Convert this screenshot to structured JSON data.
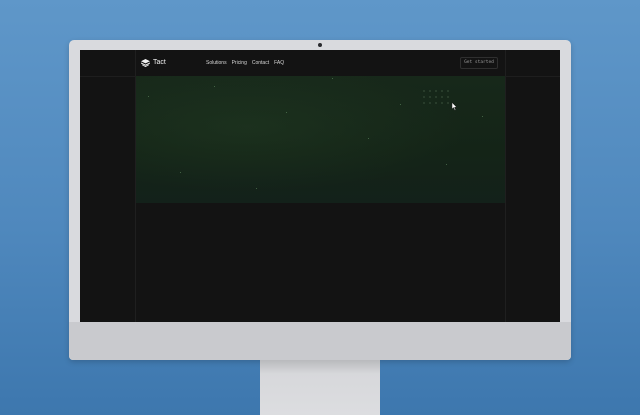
{
  "site": {
    "logo_text": "Tact",
    "logo_icon": "layers-icon",
    "nav_links": [
      "Solutions",
      "Pricing",
      "Contact",
      "FAQ"
    ],
    "cta_label": "Get started",
    "cursor_icon": "pointer-icon"
  },
  "colors": {
    "background": "#4f88bd",
    "monitor_bezel": "#d9dade",
    "screen_bg": "#131313",
    "hero_bg": "#142417",
    "text": "#f2f2f2"
  }
}
